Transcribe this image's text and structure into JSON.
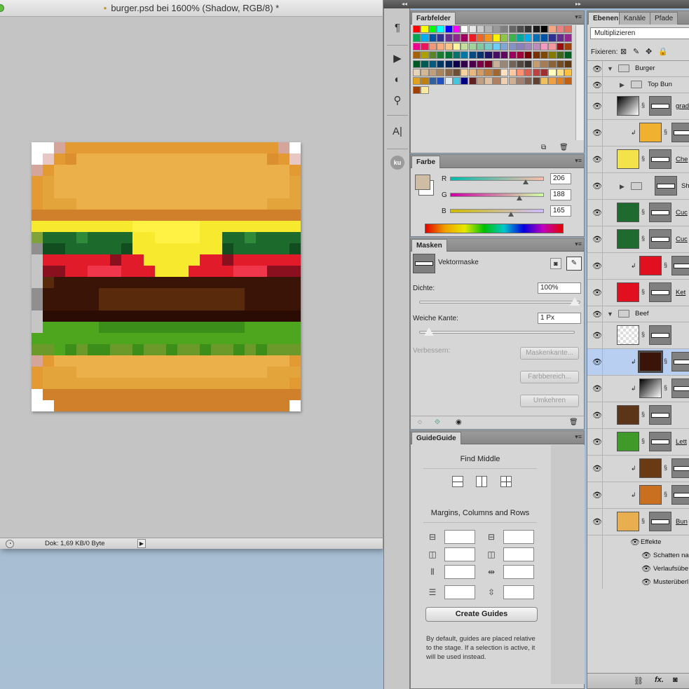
{
  "document": {
    "title": "burger.psd bei 1600% (Shadow, RGB/8) *",
    "dirty_marker": "•",
    "status_doc": "Dok: 1,69 KB/0 Byte",
    "pixel_art": {
      "cols": 24,
      "rows": 24,
      "palette": {
        "w": "#ffffff",
        "o": "#dc8f2e",
        "O": "#e49a33",
        "c": "#e4a43c",
        "C": "#ecb04a",
        "k": "#d07f2a",
        "y": "#f7ea2e",
        "Y": "#fff244",
        "g": "#2f8a3a",
        "G": "#1c6b2c",
        "D": "#124d1f",
        "l": "#7fa23a",
        "r": "#e11b2a",
        "R": "#f0364a",
        "m": "#8a1020",
        "b": "#3a1406",
        "B": "#5a2a0c",
        "n": "#2a0c04",
        "t": "#4ea61e",
        "T": "#3b8e1a",
        "h": "#6b9a2a",
        "p": "#e8c8c4",
        "q": "#d4a59a",
        "s": "#c5c5c5",
        "x": "#8f8f8f"
      },
      "grid": [
        "wwqOOOOOOOOOOOOOOOOOOOqww",
        "wpOoCCCCCCCCCCCCCCCCCoOpw",
        "qOCCCCCCCCCCCCCCCCCCCCCOq",
        "OcCCCCCCCCCCCCCCCCCCCCCcO",
        "OcCCCCCCCCCCCCCCCCCCCCCcO",
        "OcccCCCCCCCCCCCCCCCCCcccO",
        "kkkkkkkkkkkkkkkkkkkkkkkkk",
        "yyyyyyyyyYYYYYYyyyyyyyyyy",
        "lGGGgGGGGyyYYYYyyGGgGGGGl",
        "xDDGGGGGDyyyyyyyyDGGGGGDx",
        "srrrrrrmrryyyyyrrmrrrrrrs",
        "smmrrRRRrrryyyrrrrRRRmmms",
        "sBbbbbbbbbbbbbbbbbbbbbbbs",
        "xbbbbbBBBBBBBBBBBBBbbbbbx",
        "xbbbbbBBBBBBBBBBBBBbbbbbx",
        "snnnnnnnnnnnnnnnnnnnnnnnw",
        "stttttTTTTTTTTTTTTTttttts",
        "tttttttttttttttttttttttth",
        "hhtThTThhThhThhThhThThhhh",
        "qOCCCCCCCCCCCCCCCCCCCCCOq",
        "OcccCCCCCCCCCCCCCCCCCcccO",
        "OccccccccccccccccccccccO",
        "wkkkkkkkkkkkkkkkkkkkkkkkw",
        "wwkkkkkkkkkkkkkkkkkkkkkww"
      ]
    }
  },
  "panels": {
    "swatches": {
      "tab": "Farbfelder",
      "colors": [
        "#ff0000",
        "#ffff00",
        "#00ff00",
        "#00ffff",
        "#0000ff",
        "#ff00ff",
        "#ffffff",
        "#e6e6e6",
        "#cccccc",
        "#b3b3b3",
        "#999999",
        "#808080",
        "#666666",
        "#4d4d4d",
        "#333333",
        "#1a1a1a",
        "#000000",
        "#f4a582",
        "#f08080",
        "#e07060",
        "#00a651",
        "#00aeef",
        "#0054a6",
        "#2e3192",
        "#662d91",
        "#92278f",
        "#9e005d",
        "#ed1c24",
        "#f26522",
        "#f7941d",
        "#fff200",
        "#8dc63f",
        "#39b54a",
        "#00a99d",
        "#00aeef",
        "#0072bc",
        "#0054a6",
        "#2e3192",
        "#662d91",
        "#92278f",
        "#ec008c",
        "#ed145b",
        "#f69679",
        "#f9ad81",
        "#fdc689",
        "#fff799",
        "#c4df9b",
        "#a3d39c",
        "#82ca9d",
        "#7accc8",
        "#6dcff6",
        "#7da7d9",
        "#8393ca",
        "#8781bd",
        "#a186be",
        "#bd8cbf",
        "#f49ac1",
        "#f5989d",
        "#9e0b0f",
        "#a0410d",
        "#a36209",
        "#aba000",
        "#598527",
        "#1a7b30",
        "#007236",
        "#00746b",
        "#0076a3",
        "#004a80",
        "#003471",
        "#1b1464",
        "#440e62",
        "#630460",
        "#9e005d",
        "#9e0039",
        "#790000",
        "#7b2e00",
        "#7d4900",
        "#827b00",
        "#406618",
        "#005e20",
        "#005826",
        "#005952",
        "#005b7f",
        "#003663",
        "#002157",
        "#0d004c",
        "#32004b",
        "#4b0049",
        "#7b0046",
        "#7a0026",
        "#c7b299",
        "#998675",
        "#736357",
        "#534741",
        "#37302d",
        "#c69c6d",
        "#a67c52",
        "#8c6239",
        "#754c24",
        "#603913",
        "#e6d4b8",
        "#d4b896",
        "#bfa07a",
        "#a8855f",
        "#8c6a45",
        "#704f30",
        "#f5d0a0",
        "#e8b880",
        "#d49a60",
        "#c08040",
        "#a06830",
        "#ffe0c0",
        "#ffc8a0",
        "#ff9070",
        "#e06050",
        "#c04040",
        "#a03030",
        "#ffffc0",
        "#ffe080",
        "#ffc040",
        "#e0a020",
        "#c08010",
        "#3060a0",
        "#2050c0",
        "#e0e8f0",
        "#40c8e0",
        "#000080",
        "#602020",
        "#c0a080",
        "#e0c0a0",
        "#b08060",
        "#f0d0b0",
        "#d0b090",
        "#a08070",
        "#806050",
        "#604030",
        "#f0c060",
        "#f0a040",
        "#e08020",
        "#c06010",
        "#a04000",
        "#f8e8a0"
      ]
    },
    "color": {
      "tab": "Farbe",
      "fg_color": "#cebca5",
      "r_label": "R",
      "g_label": "G",
      "b_label": "B",
      "r_value": "206",
      "g_value": "188",
      "b_value": "165",
      "r_level": 206,
      "g_level": 188,
      "b_level": 165
    },
    "masks": {
      "tab": "Masken",
      "mask_type": "Vektormaske",
      "density_label": "Dichte:",
      "density_value": "100%",
      "density_level": 100,
      "feather_label": "Weiche Kante:",
      "feather_value": "1 Px",
      "feather_level": 2,
      "refine_label": "Verbessern:",
      "mask_edge_button": "Maskenkante...",
      "color_range_button": "Farbbereich...",
      "invert_button": "Umkehren"
    },
    "guideguide": {
      "tab": "GuideGuide",
      "find_middle": "Find Middle",
      "mcr_title": "Margins, Columns and Rows",
      "create_button": "Create Guides",
      "note": "By default, guides are placed relative to the stage. If a selection is active, it will be used instead."
    },
    "layers": {
      "tabs": [
        "Ebenen",
        "Kanäle",
        "Pfade"
      ],
      "blend_mode": "Multiplizieren",
      "lock_label": "Fixieren:",
      "rows": [
        {
          "name": "Burger",
          "kind": "group"
        },
        {
          "name": "Top Bun",
          "kind": "group-collapsed"
        },
        {
          "name": "grad",
          "kind": "layer",
          "thumb": "grad"
        },
        {
          "name": "",
          "kind": "clip",
          "thumb": "#f0b030"
        },
        {
          "name": "Che",
          "kind": "layer",
          "thumb": "#f4e24a"
        },
        {
          "name": "Sh",
          "kind": "group-collapsed-mask"
        },
        {
          "name": "Cuc",
          "kind": "layer",
          "thumb": "#1f6a2e"
        },
        {
          "name": "Cuc",
          "kind": "layer",
          "thumb": "#1f6a2e"
        },
        {
          "name": "",
          "kind": "clip",
          "thumb": "#e01020"
        },
        {
          "name": "Ket",
          "kind": "layer",
          "thumb": "#e01020"
        },
        {
          "name": "Beef",
          "kind": "group"
        },
        {
          "name": "",
          "kind": "layer",
          "thumb": "checker"
        },
        {
          "name": "",
          "kind": "clip-sel",
          "thumb": "#3a1408"
        },
        {
          "name": "",
          "kind": "clip",
          "thumb": "grad"
        },
        {
          "name": "",
          "kind": "layer",
          "thumb": "#5c3418"
        },
        {
          "name": "Lett",
          "kind": "layer",
          "thumb": "#3f9a2a"
        },
        {
          "name": "",
          "kind": "clip",
          "thumb": "#6a3a14"
        },
        {
          "name": "",
          "kind": "clip",
          "thumb": "#c87020"
        },
        {
          "name": "Bun",
          "kind": "layer",
          "thumb": "#e8ae50"
        }
      ],
      "effects_label": "Effekte",
      "effects": [
        "Schatten nac",
        "Verlaufsübe",
        "Musterüberl"
      ]
    }
  }
}
